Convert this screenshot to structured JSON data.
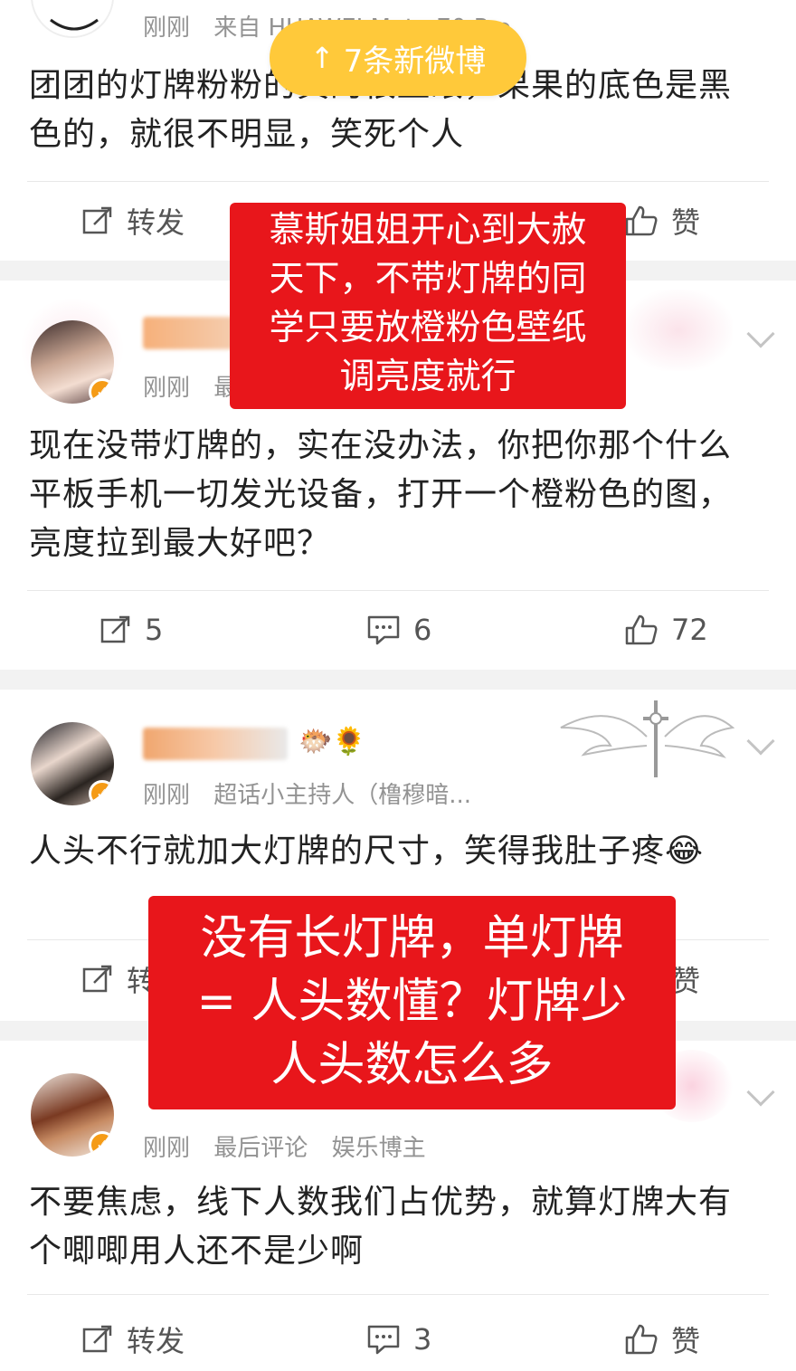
{
  "toast": {
    "label": "7条新微博"
  },
  "overlays": {
    "first": {
      "lines": [
        "慕斯姐姐开心到大赦",
        "天下，不带灯牌的同",
        "学只要放橙粉色壁纸",
        "调亮度就行"
      ]
    },
    "second": {
      "lines": [
        "没有长灯牌，单灯牌",
        "= 人头数懂？灯牌少",
        "人头数怎么多"
      ]
    }
  },
  "posts": [
    {
      "time": "刚刚",
      "source": "来自 HUAWEI Mate 70 Pro",
      "content": "团团的灯牌粉粉的真的很显眼，果果的底色是黑色的，就很不明显，笑死个人",
      "repost": "转发",
      "comment": "",
      "like": "赞"
    },
    {
      "time": "刚刚",
      "source": "最后评论",
      "content": "现在没带灯牌的，实在没办法，你把你那个什么平板手机一切发光设备，打开一个橙粉色的图，亮度拉到最大好吧？",
      "repost": "5",
      "comment": "6",
      "like": "72"
    },
    {
      "time": "刚刚",
      "source": "超话小主持人（橹穆暗...",
      "content": "人头不行就加大灯牌的尺寸，笑得我肚子疼😂",
      "repost": "转发",
      "comment": "",
      "like": "赞"
    },
    {
      "time": "刚刚",
      "source": "最后评论",
      "tag": "娱乐博主",
      "content": "不要焦虑，线下人数我们占优势，就算灯牌大有个唧唧用人还不是少啊",
      "repost": "转发",
      "comment": "3",
      "like": "赞"
    }
  ],
  "colors": {
    "accent": "#ffc93a",
    "overlay": "#e8161b",
    "badge": "#f59b16",
    "gap": "#f2f2f2"
  }
}
